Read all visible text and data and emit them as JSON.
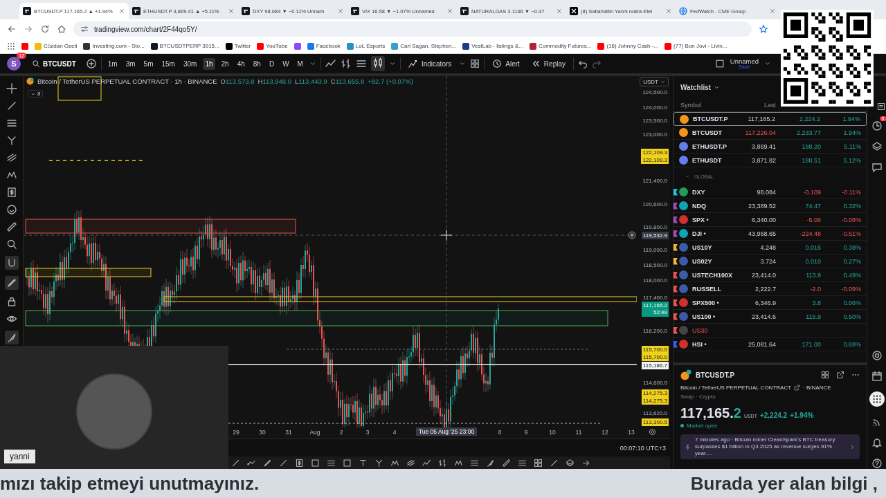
{
  "browser": {
    "tabs": [
      {
        "label": "BTCUSDT.P 117,165.2 ▲ +1.94%",
        "selected": true
      },
      {
        "label": "ETHUSDT.P 3,869.41 ▲ +5.11%",
        "selected": false
      },
      {
        "label": "DXY 98.084 ▼ −0.11% Unnam",
        "selected": false
      },
      {
        "label": "VIX 16.58 ▼ −1.07% Unnamed",
        "selected": false
      },
      {
        "label": "NATURALGAS 3.1166 ▼ −0.37",
        "selected": false
      },
      {
        "label": "(8) Sabahattin Yanni nokta Etel",
        "selected": false
      },
      {
        "label": "FedWatch - CME Group",
        "selected": false
      }
    ],
    "address": "tradingview.com/chart/2F44qo5Y/",
    "bookmarks": [
      {
        "color": "#ff0000"
      },
      {
        "label": "Cüzdan Özeti",
        "color": "#f0b90b"
      },
      {
        "label": "Investing.com - Sto...",
        "color": "#333333"
      },
      {
        "label": "BTCUSDTPERP 3915...",
        "color": "#131722"
      },
      {
        "label": "Twitter",
        "color": "#000000"
      },
      {
        "label": "YouTube",
        "color": "#ff0000"
      },
      {
        "color": "#9146ff"
      },
      {
        "label": "Facebook",
        "color": "#1877f2"
      },
      {
        "label": "LoL Esports",
        "color": "#2c8fc9"
      },
      {
        "label": "Carl Sagan, Stephen...",
        "color": "#3aa0c8"
      },
      {
        "label": "VestLab - listings &...",
        "color": "#1e3a8a"
      },
      {
        "label": "Commodity Futures...",
        "color": "#b22234"
      },
      {
        "label": "(16) Johnny Cash -...",
        "color": "#ff0000"
      },
      {
        "label": "(77) Bon Jovi - Livin...",
        "color": "#ff0000"
      }
    ]
  },
  "toolbar": {
    "avatar": "S",
    "badge": "12",
    "symbol": "BTCUSDT",
    "intervals": [
      {
        "label": "1m",
        "selected": false
      },
      {
        "label": "3m",
        "selected": false
      },
      {
        "label": "5m",
        "selected": false
      },
      {
        "label": "15m",
        "selected": false
      },
      {
        "label": "30m",
        "selected": false
      },
      {
        "label": "1h",
        "selected": true
      },
      {
        "label": "2h",
        "selected": false
      },
      {
        "label": "4h",
        "selected": false
      },
      {
        "label": "8h",
        "selected": false
      },
      {
        "label": "D",
        "selected": false
      },
      {
        "label": "W",
        "selected": false
      },
      {
        "label": "M",
        "selected": false
      }
    ],
    "indicators": "Indicators",
    "alert": "Alert",
    "replay": "Replay",
    "layout": {
      "name": "Unnamed",
      "status": "Save"
    }
  },
  "chart": {
    "legend": {
      "title": "Bitcoin / TetherUS PERPETUAL CONTRACT · 1h · BINANCE",
      "ohlc": [
        {
          "key": "O",
          "value": "113,573.8"
        },
        {
          "key": "H",
          "value": "113,948.0"
        },
        {
          "key": "L",
          "value": "113,443.9"
        },
        {
          "key": "C",
          "value": "113,655.8"
        }
      ],
      "change": "+82.7 (+0.07%)"
    },
    "indicator_count": "8",
    "currency": "USDT",
    "price_labels": [
      {
        "text": "124,500.0",
        "kind": "plain"
      },
      {
        "text": "124,000.0",
        "kind": "plain"
      },
      {
        "text": "123,500.0",
        "kind": "plain"
      },
      {
        "text": "123,000.0",
        "kind": "plain"
      },
      {
        "text": "122,109.3",
        "kind": "marker"
      },
      {
        "text": "122,109.3",
        "kind": "marker"
      },
      {
        "text": "121,400.0",
        "kind": "plain"
      },
      {
        "text": "120,600.0",
        "kind": "plain"
      },
      {
        "text": "119,800.0",
        "kind": "plain"
      },
      {
        "text": "119,532.9",
        "kind": "crosshair"
      },
      {
        "text": "119,000.0",
        "kind": "plain"
      },
      {
        "text": "118,500.0",
        "kind": "plain"
      },
      {
        "text": "118,000.0",
        "kind": "plain"
      },
      {
        "text": "117,400.0",
        "kind": "plain"
      },
      {
        "text": "117,165.2",
        "sub": "52:49",
        "kind": "current"
      },
      {
        "text": "116,200.0",
        "kind": "plain"
      },
      {
        "text": "115,700.0",
        "kind": "marker"
      },
      {
        "text": "115,700.0",
        "kind": "marker"
      },
      {
        "text": "115,186.7",
        "kind": "line"
      },
      {
        "text": "114,600.0",
        "kind": "plain"
      },
      {
        "text": "114,275.3",
        "kind": "marker"
      },
      {
        "text": "114,275.3",
        "kind": "marker"
      },
      {
        "text": "113,620.0",
        "kind": "plain"
      },
      {
        "text": "113,300.5",
        "kind": "marker"
      }
    ],
    "time_labels": [
      {
        "text": "29",
        "kind": "plain"
      },
      {
        "text": "30",
        "kind": "plain"
      },
      {
        "text": "31",
        "kind": "plain"
      },
      {
        "text": "Aug",
        "kind": "plain"
      },
      {
        "text": "2",
        "kind": "plain"
      },
      {
        "text": "3",
        "kind": "plain"
      },
      {
        "text": "4",
        "kind": "plain"
      },
      {
        "text": "Tue 05 Aug '25   23:00",
        "kind": "crosshair"
      },
      {
        "text": "8",
        "kind": "plain"
      },
      {
        "text": "9",
        "kind": "plain"
      },
      {
        "text": "10",
        "kind": "plain"
      },
      {
        "text": "11",
        "kind": "plain"
      },
      {
        "text": "12",
        "kind": "plain"
      },
      {
        "text": "13",
        "kind": "plain"
      }
    ],
    "clock": "00:07:10 UTC+3"
  },
  "watchlist": {
    "title": "Watchlist",
    "columns": [
      "Symbol",
      "Last"
    ],
    "rows": [
      {
        "symbol": "BTCUSDT.P",
        "last": "117,165.2",
        "change": "2,224.2",
        "change_pct": "1.94%",
        "negative": false,
        "last_negative": false,
        "selected": true
      },
      {
        "symbol": "BTCUSDT",
        "last": "117,226.04",
        "change": "2,233.77",
        "change_pct": "1.94%",
        "negative": false,
        "last_negative": true,
        "selected": false
      },
      {
        "symbol": "ETHUSDT.P",
        "last": "3,869.41",
        "change": "188.20",
        "change_pct": "5.11%",
        "negative": false,
        "last_negative": false,
        "selected": false
      },
      {
        "symbol": "ETHUSDT",
        "last": "3,871.82",
        "change": "188.51",
        "change_pct": "5.12%",
        "negative": false,
        "last_negative": false,
        "selected": false
      }
    ],
    "group": {
      "label": "GLOBAL",
      "expanded": true,
      "rows": [
        {
          "symbol": "DXY",
          "last": "98.084",
          "change": "-0.109",
          "change_pct": "-0.11%",
          "negative": true,
          "color": "#22c3e6",
          "selected": false
        },
        {
          "symbol": "NDQ",
          "last": "23,389.52",
          "change": "74.47",
          "change_pct": "0.32%",
          "negative": false,
          "color": "#ab47bc",
          "selected": false
        },
        {
          "symbol": "SPX •",
          "last": "6,340.00",
          "change": "-5.06",
          "change_pct": "-0.08%",
          "negative": true,
          "color": "#ab47bc",
          "selected": false
        },
        {
          "symbol": "DJI •",
          "last": "43,968.65",
          "change": "-224.48",
          "change_pct": "-0.51%",
          "negative": true,
          "color": "#ab47bc",
          "selected": false
        },
        {
          "symbol": "US10Y",
          "last": "4.248",
          "change": "0.016",
          "change_pct": "0.38%",
          "negative": false,
          "color": "#f2b92c",
          "selected": false
        },
        {
          "symbol": "US02Y",
          "last": "3.724",
          "change": "0.010",
          "change_pct": "0.27%",
          "negative": false,
          "color": "#f2b92c",
          "selected": false
        },
        {
          "symbol": "USTECH100X",
          "last": "23,414.0",
          "change": "113.9",
          "change_pct": "0.49%",
          "negative": false,
          "color": "#ef5350",
          "selected": false
        },
        {
          "symbol": "RUSSELL",
          "last": "2,222.7",
          "change": "-2.0",
          "change_pct": "-0.09%",
          "negative": true,
          "color": "#ef5350",
          "selected": false
        },
        {
          "symbol": "SPX500 •",
          "last": "6,346.9",
          "change": "3.8",
          "change_pct": "0.06%",
          "negative": false,
          "color": "#ef5350",
          "selected": false
        },
        {
          "symbol": "US100 •",
          "last": "23,414.6",
          "change": "116.9",
          "change_pct": "0.50%",
          "negative": false,
          "color": "#ef5350",
          "selected": false
        },
        {
          "symbol": "US30",
          "unavailable": true,
          "color": "#ef5350",
          "selected": false
        },
        {
          "symbol": "HSI •",
          "last": "25,081.64",
          "change": "171.00",
          "change_pct": "0.69%",
          "negative": false,
          "color": "#2962ff",
          "selected": false
        }
      ]
    }
  },
  "details": {
    "symbol": "BTCUSDT.P",
    "description": "Bitcoin / TetherUS PERPETUAL CONTRACT",
    "exchange": "· BINANCE",
    "type": "Swap · Crypto",
    "price_main": "117,165.",
    "price_last": "2",
    "currency": "USDT",
    "change": "+2,224.2",
    "change_pct": "+1.94%",
    "market_status": "Market open",
    "news": "7 minutes ago · Bitcoin miner CleanSpark's BTC treasury surpasses $1 billion in Q3 2025 as revenue surges 91% year-..."
  },
  "sidebar_badge": "5",
  "webcam": {
    "label": "yanni"
  },
  "subtitle": {
    "left": "mızı takip etmeyi unutmayınız.",
    "right": "Burada yer alan bilgi ,"
  }
}
